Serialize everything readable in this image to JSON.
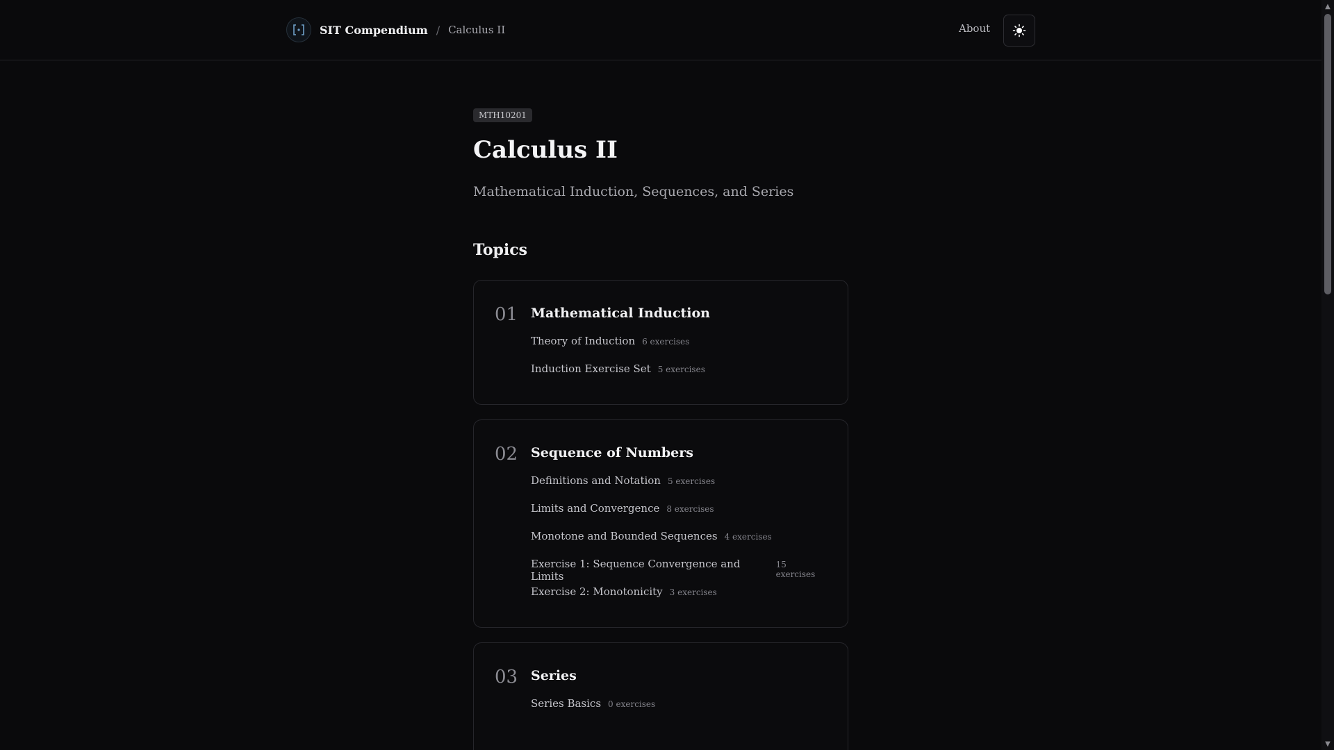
{
  "header": {
    "brand": "SIT Compendium",
    "separator": "/",
    "current": "Calculus II",
    "about_label": "About"
  },
  "icons": {
    "logo": "bracket-logo-icon",
    "theme": "sun-icon"
  },
  "course": {
    "code": "MTH10201",
    "title": "Calculus II",
    "subtitle": "Mathematical Induction, Sequences, and Series"
  },
  "topics_heading": "Topics",
  "cards": [
    {
      "num": "01",
      "title": "Mathematical Induction",
      "items": [
        {
          "name": "Theory of Induction",
          "count": "6 exercises"
        },
        {
          "name": "Induction Exercise Set",
          "count": "5 exercises"
        }
      ]
    },
    {
      "num": "02",
      "title": "Sequence of Numbers",
      "items": [
        {
          "name": "Definitions and Notation",
          "count": "5 exercises"
        },
        {
          "name": "Limits and Convergence",
          "count": "8 exercises"
        },
        {
          "name": "Monotone and Bounded Sequences",
          "count": "4 exercises"
        },
        {
          "name": "Exercise 1: Sequence Convergence and Limits",
          "count": "15 exercises"
        },
        {
          "name": "Exercise 2: Monotonicity",
          "count": "3 exercises"
        }
      ]
    },
    {
      "num": "03",
      "title": "Series",
      "items": [
        {
          "name": "Series Basics",
          "count": "0 exercises"
        }
      ]
    }
  ],
  "colors": {
    "background": "#0a0a0c",
    "card_border": "#26262b",
    "badge_bg": "#2a2a2e"
  }
}
